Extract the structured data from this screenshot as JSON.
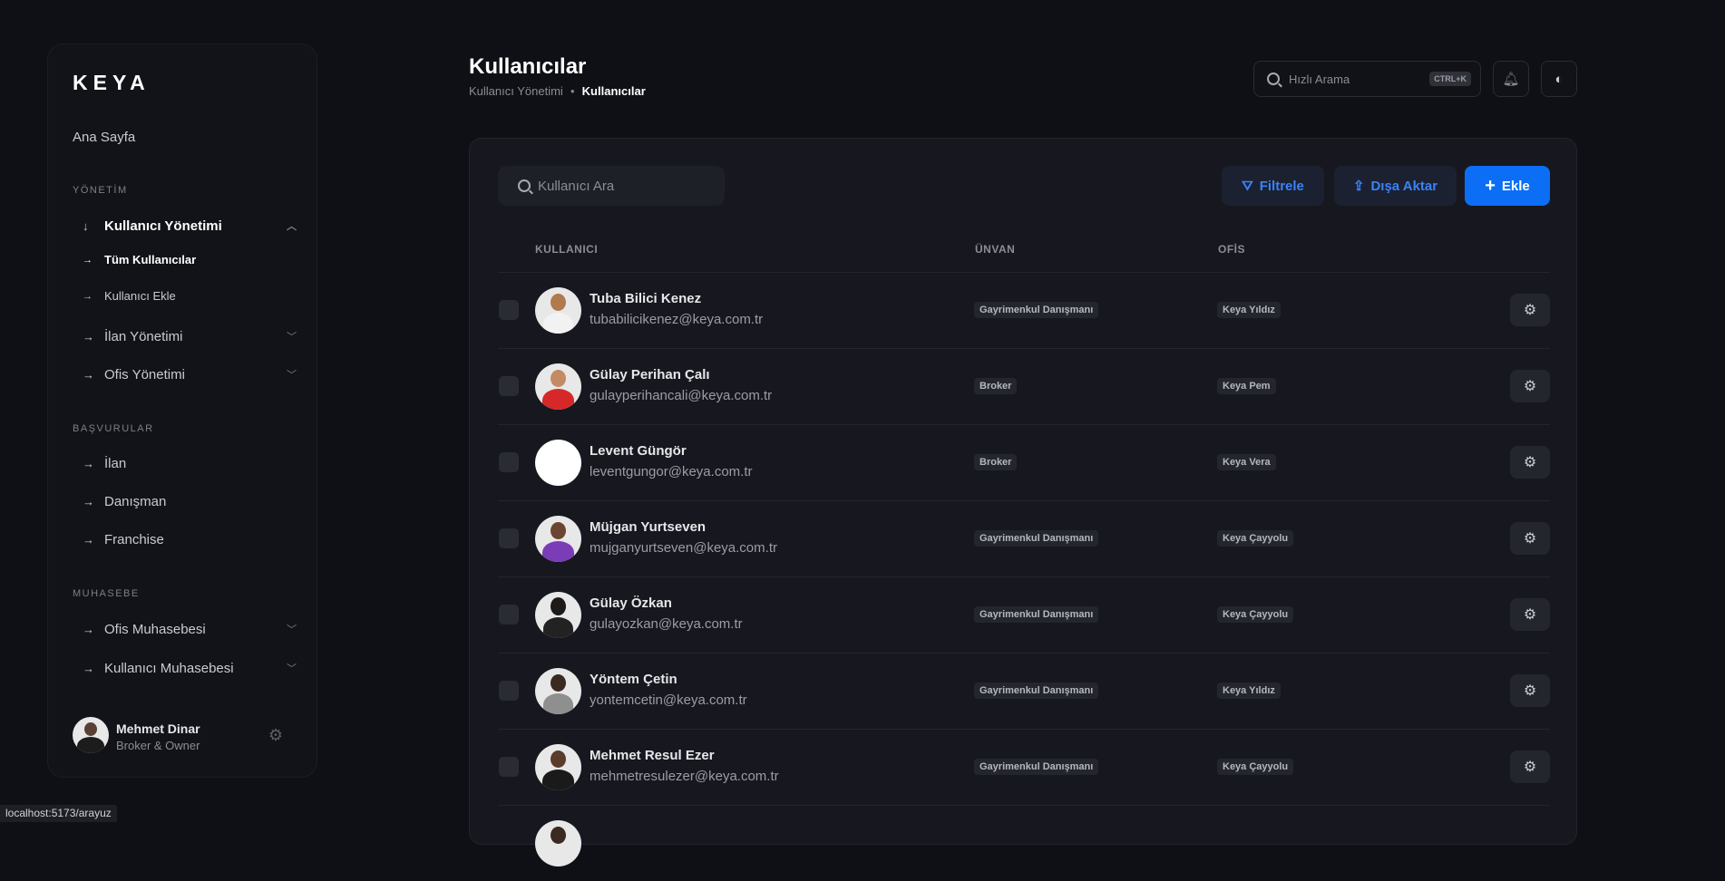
{
  "brand": "KEYA",
  "sidebar": {
    "home": "Ana Sayfa",
    "sections": {
      "yonetim": "YÖNETİM",
      "basvurular": "BAŞVURULAR",
      "muhasebe": "MUHASEBE"
    },
    "nav": {
      "kullanici_yonetimi": "Kullanıcı Yönetimi",
      "tum_kullanicilar": "Tüm Kullanıcılar",
      "kullanici_ekle": "Kullanıcı Ekle",
      "ilan_yonetimi": "İlan Yönetimi",
      "ofis_yonetimi": "Ofis Yönetimi",
      "ilan": "İlan",
      "danisman": "Danışman",
      "franchise": "Franchise",
      "ofis_muhasebesi": "Ofis Muhasebesi",
      "kullanici_muhasebesi": "Kullanıcı Muhasebesi"
    },
    "profile": {
      "name": "Mehmet Dinar",
      "role": "Broker & Owner"
    }
  },
  "header": {
    "title": "Kullanıcılar",
    "breadcrumb_parent": "Kullanıcı Yönetimi",
    "breadcrumb_current": "Kullanıcılar",
    "quick_search_placeholder": "Hızlı Arama",
    "shortcut": "CTRL+K"
  },
  "toolbar": {
    "search_placeholder": "Kullanıcı Ara",
    "filter_label": "Filtrele",
    "export_label": "Dışa Aktar",
    "add_label": "Ekle"
  },
  "table": {
    "columns": [
      "KULLANICI",
      "ÜNVAN",
      "OFİS"
    ],
    "rows": [
      {
        "name": "Tuba Bilici Kenez",
        "email": "tubabilicikenez@keya.com.tr",
        "title": "Gayrimenkul Danışmanı",
        "office": "Keya Yıldız"
      },
      {
        "name": "Gülay Perihan Çalı",
        "email": "gulayperihancali@keya.com.tr",
        "title": "Broker",
        "office": "Keya Pem"
      },
      {
        "name": "Levent Güngör",
        "email": "leventgungor@keya.com.tr",
        "title": "Broker",
        "office": "Keya Vera"
      },
      {
        "name": "Müjgan Yurtseven",
        "email": "mujganyurtseven@keya.com.tr",
        "title": "Gayrimenkul Danışmanı",
        "office": "Keya Çayyolu"
      },
      {
        "name": "Gülay Özkan",
        "email": "gulayozkan@keya.com.tr",
        "title": "Gayrimenkul Danışmanı",
        "office": "Keya Çayyolu"
      },
      {
        "name": "Yöntem Çetin",
        "email": "yontemcetin@keya.com.tr",
        "title": "Gayrimenkul Danışmanı",
        "office": "Keya Yıldız"
      },
      {
        "name": "Mehmet Resul Ezer",
        "email": "mehmetresulezer@keya.com.tr",
        "title": "Gayrimenkul Danışmanı",
        "office": "Keya Çayyolu"
      }
    ]
  },
  "status_bar": "localhost:5173/arayuz",
  "colors": {
    "background": "#0f1015",
    "accent": "#0b6ef5",
    "accent_text": "#3b82f6"
  }
}
